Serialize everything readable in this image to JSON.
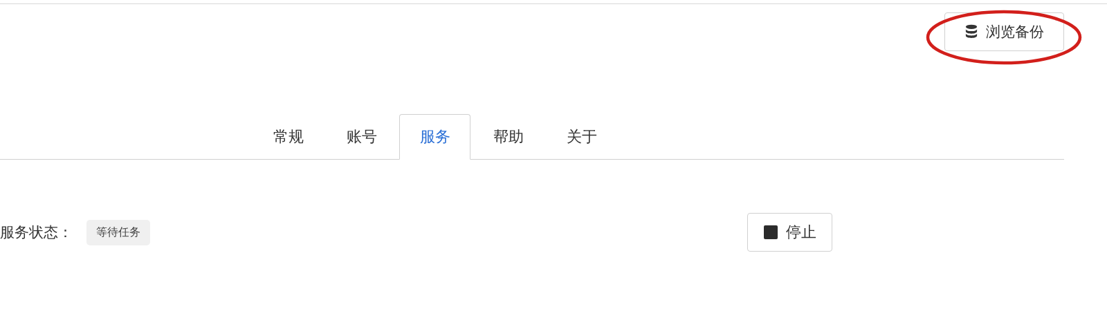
{
  "header": {
    "browse_button": {
      "label": "浏览备份",
      "highlighted": true
    }
  },
  "tabs": [
    {
      "label": "常规",
      "selected": false
    },
    {
      "label": "账号",
      "selected": false
    },
    {
      "label": "服务",
      "selected": true
    },
    {
      "label": "帮助",
      "selected": false
    },
    {
      "label": "关于",
      "selected": false
    }
  ],
  "service": {
    "status_label": "服务状态：",
    "status_badge": "等待任务",
    "stop_button": {
      "label": "停止"
    }
  }
}
